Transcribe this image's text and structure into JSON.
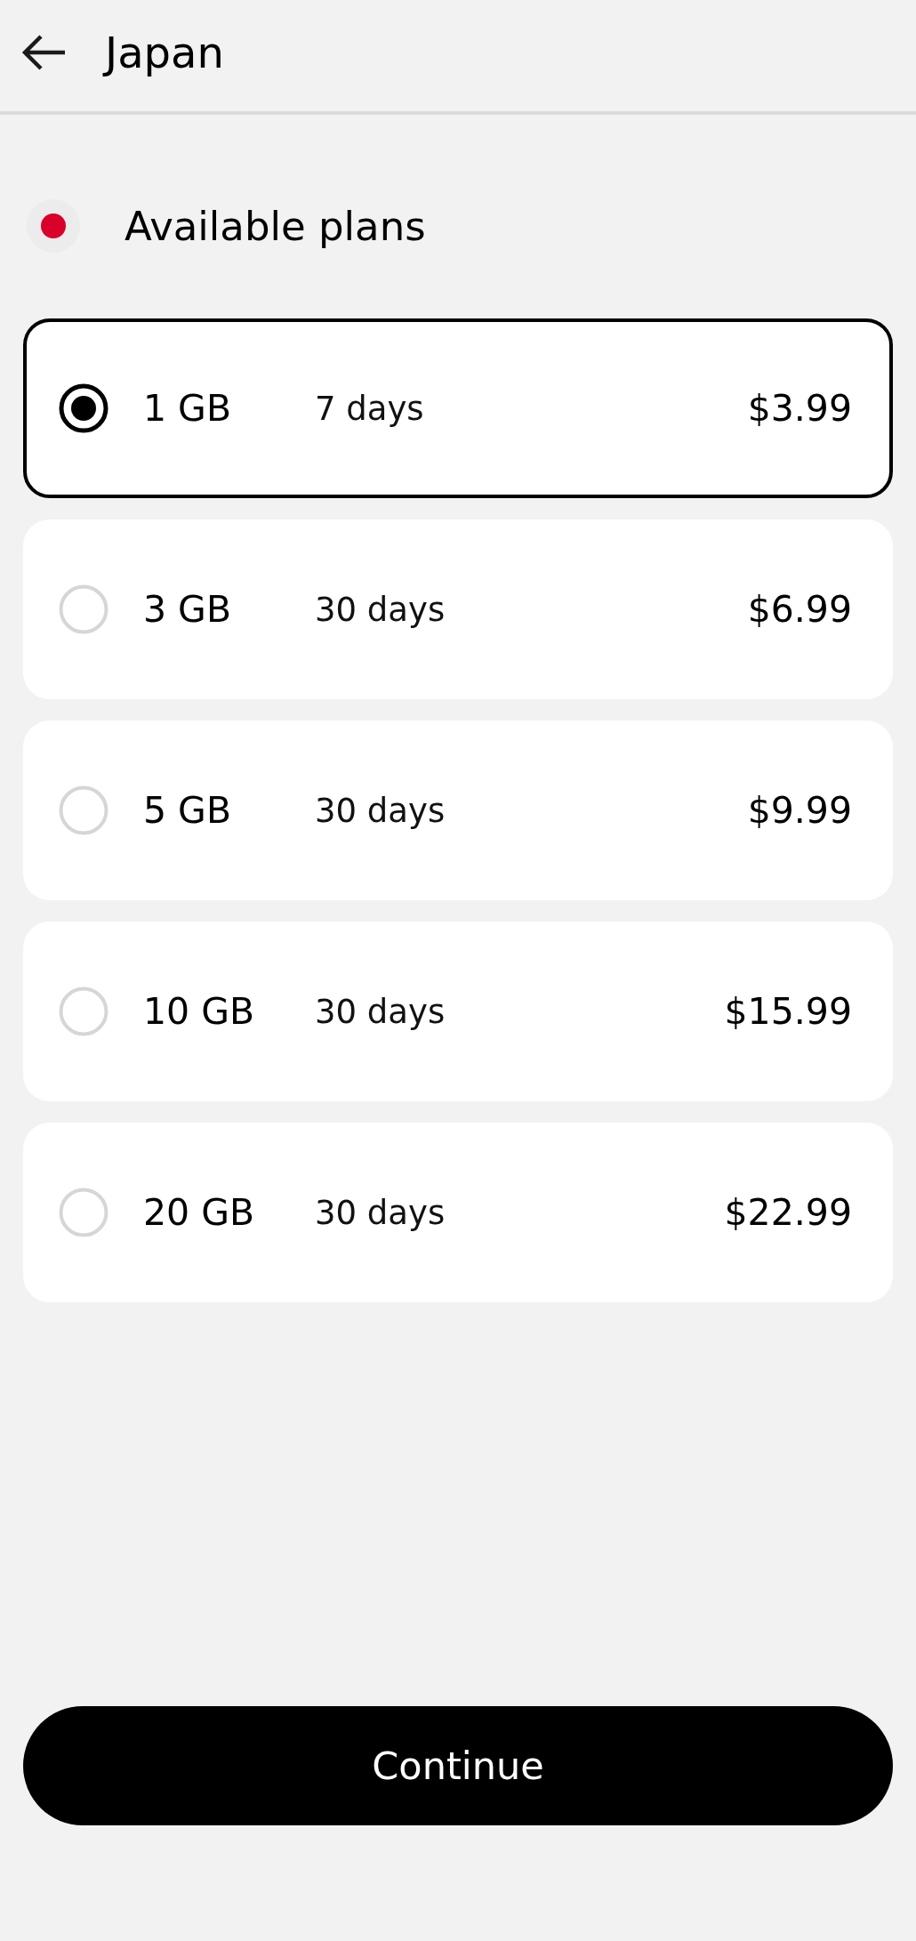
{
  "header": {
    "title": "Japan"
  },
  "section": {
    "title": "Available plans"
  },
  "plans": [
    {
      "data": "1 GB",
      "duration": "7 days",
      "price": "$3.99",
      "selected": true
    },
    {
      "data": "3 GB",
      "duration": "30 days",
      "price": "$6.99",
      "selected": false
    },
    {
      "data": "5 GB",
      "duration": "30 days",
      "price": "$9.99",
      "selected": false
    },
    {
      "data": "10 GB",
      "duration": "30 days",
      "price": "$15.99",
      "selected": false
    },
    {
      "data": "20 GB",
      "duration": "30 days",
      "price": "$22.99",
      "selected": false
    }
  ],
  "continue_button": {
    "label": "Continue"
  }
}
